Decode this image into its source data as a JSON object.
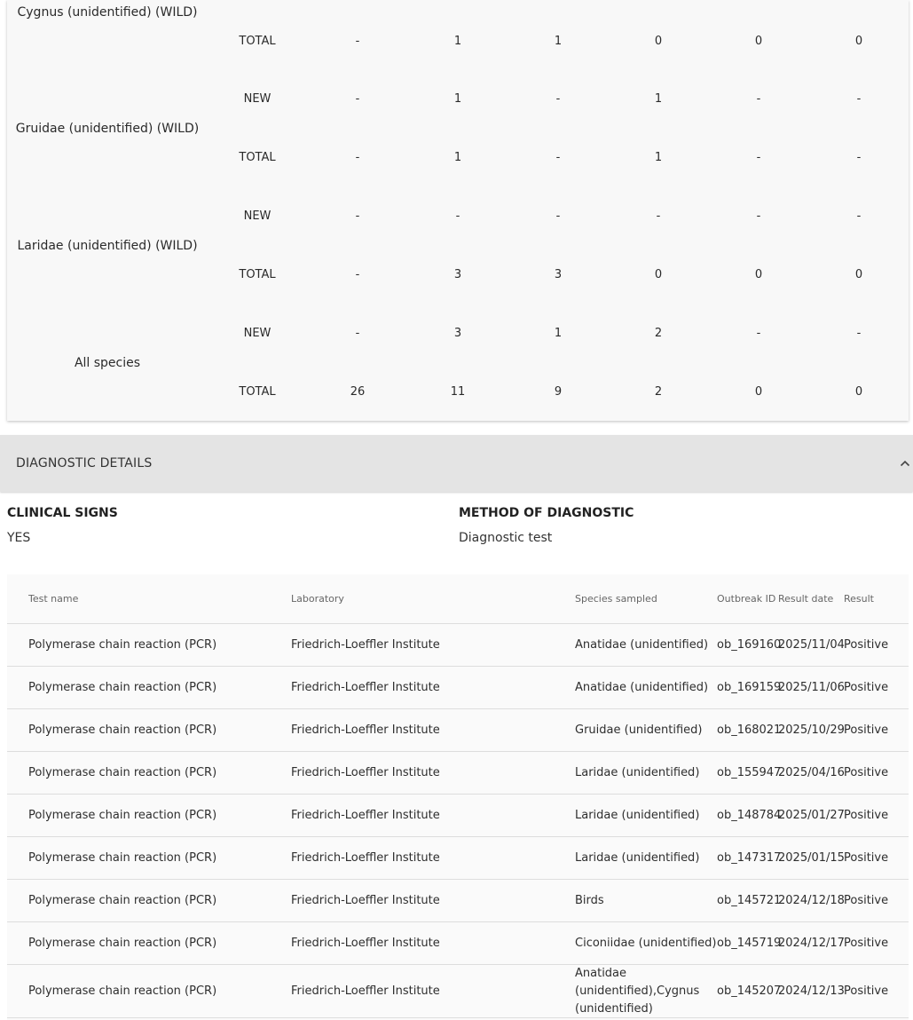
{
  "species_table": {
    "groups": [
      {
        "name": "Cygnus (unidentified) (WILD)",
        "rows": [
          {
            "type": "TOTAL",
            "values": [
              "-",
              "1",
              "1",
              "0",
              "0",
              "0"
            ]
          }
        ]
      },
      {
        "name": "Gruidae (unidentified) (WILD)",
        "rows": [
          {
            "type": "NEW",
            "values": [
              "-",
              "1",
              "-",
              "1",
              "-",
              "-"
            ]
          },
          {
            "type": "TOTAL",
            "values": [
              "-",
              "1",
              "-",
              "1",
              "-",
              "-"
            ]
          }
        ]
      },
      {
        "name": "Laridae (unidentified) (WILD)",
        "rows": [
          {
            "type": "NEW",
            "values": [
              "-",
              "-",
              "-",
              "-",
              "-",
              "-"
            ]
          },
          {
            "type": "TOTAL",
            "values": [
              "-",
              "3",
              "3",
              "0",
              "0",
              "0"
            ]
          }
        ]
      },
      {
        "name": "All species",
        "rows": [
          {
            "type": "NEW",
            "values": [
              "-",
              "3",
              "1",
              "2",
              "-",
              "-"
            ]
          },
          {
            "type": "TOTAL",
            "values": [
              "26",
              "11",
              "9",
              "2",
              "0",
              "0"
            ]
          }
        ]
      }
    ]
  },
  "diagnostic": {
    "header": "DIAGNOSTIC DETAILS",
    "clinical_signs_label": "CLINICAL SIGNS",
    "clinical_signs_value": "YES",
    "method_label": "METHOD OF DIAGNOSTIC",
    "method_value": "Diagnostic test",
    "table": {
      "headers": {
        "test": "Test name",
        "lab": "Laboratory",
        "species": "Species sampled",
        "outbreak": "Outbreak ID",
        "date": "Result date",
        "result": "Result"
      },
      "rows": [
        {
          "test": "Polymerase chain reaction (PCR)",
          "lab": "Friedrich-Loeffler Institute",
          "species": "Anatidae (unidentified)",
          "outbreak": "ob_169160",
          "date": "2025/11/04",
          "result": "Positive"
        },
        {
          "test": "Polymerase chain reaction (PCR)",
          "lab": "Friedrich-Loeffler Institute",
          "species": "Anatidae (unidentified)",
          "outbreak": "ob_169159",
          "date": "2025/11/06",
          "result": "Positive"
        },
        {
          "test": "Polymerase chain reaction (PCR)",
          "lab": "Friedrich-Loeffler Institute",
          "species": "Gruidae (unidentified)",
          "outbreak": "ob_168021",
          "date": "2025/10/29",
          "result": "Positive"
        },
        {
          "test": "Polymerase chain reaction (PCR)",
          "lab": "Friedrich-Loeffler Institute",
          "species": "Laridae (unidentified)",
          "outbreak": "ob_155947",
          "date": "2025/04/16",
          "result": "Positive"
        },
        {
          "test": "Polymerase chain reaction (PCR)",
          "lab": "Friedrich-Loeffler Institute",
          "species": "Laridae (unidentified)",
          "outbreak": "ob_148784",
          "date": "2025/01/27",
          "result": "Positive"
        },
        {
          "test": "Polymerase chain reaction (PCR)",
          "lab": "Friedrich-Loeffler Institute",
          "species": "Laridae (unidentified)",
          "outbreak": "ob_147317",
          "date": "2025/01/15",
          "result": "Positive"
        },
        {
          "test": "Polymerase chain reaction (PCR)",
          "lab": "Friedrich-Loeffler Institute",
          "species": "Birds",
          "outbreak": "ob_145721",
          "date": "2024/12/18",
          "result": "Positive"
        },
        {
          "test": "Polymerase chain reaction (PCR)",
          "lab": "Friedrich-Loeffler Institute",
          "species": "Ciconiidae (unidentified)",
          "outbreak": "ob_145719",
          "date": "2024/12/17",
          "result": "Positive"
        },
        {
          "test": "Polymerase chain reaction (PCR)",
          "lab": "Friedrich-Loeffler Institute",
          "species": "Anatidae (unidentified),Cygnus (unidentified)",
          "outbreak": "ob_145207",
          "date": "2024/12/13",
          "result": "Positive"
        }
      ]
    }
  }
}
